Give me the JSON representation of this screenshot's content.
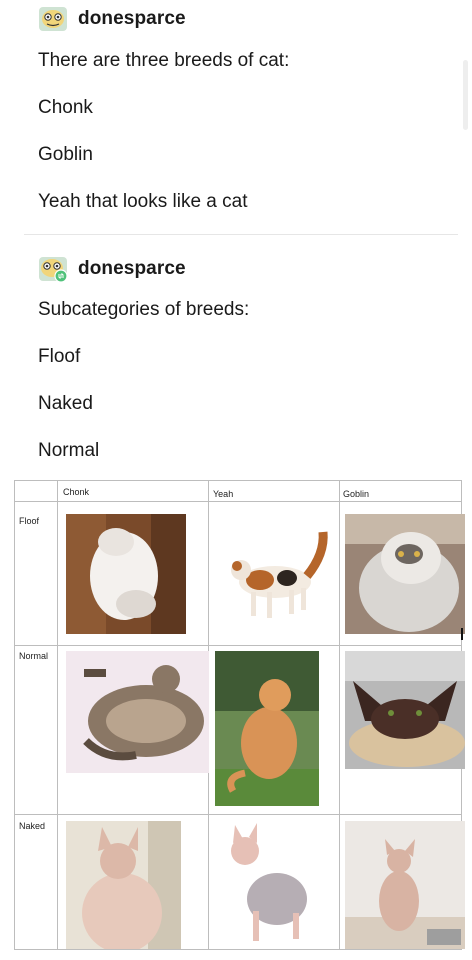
{
  "posts": [
    {
      "username": "donesparce",
      "lines": [
        "There are three breeds of cat:",
        "Chonk",
        "Goblin",
        "Yeah that looks like a cat"
      ]
    },
    {
      "username": "donesparce",
      "lines": [
        "Subcategories of breeds:",
        "Floof",
        "Naked",
        "Normal"
      ]
    }
  ],
  "table": {
    "columns": [
      "Chonk",
      "Yeah",
      "Goblin"
    ],
    "rows": [
      "Floof",
      "Normal",
      "Naked"
    ]
  },
  "icons": {
    "avatar": "avatar-icon",
    "reblog": "reblog-icon"
  },
  "colors": {
    "reblog_badge": "#4fc27a",
    "avatar_face": "#f1d57a"
  }
}
